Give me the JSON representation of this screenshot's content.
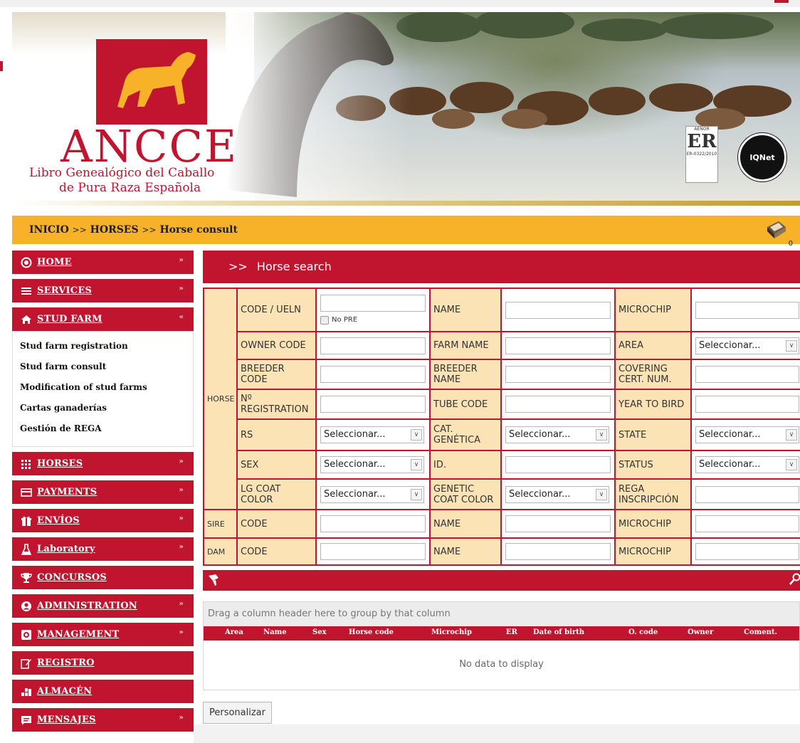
{
  "banner": {
    "brand": "ANCCE",
    "subtitle_line1": "Libro Genealógico del Caballo",
    "subtitle_line2": "de Pura Raza Española",
    "cert_aenor_top": "AENOR",
    "cert_aenor_mark": "ER",
    "cert_aenor_bottom": "ER-0322/2010",
    "cert_iqnet": "IQNet"
  },
  "breadcrumb": {
    "home": "INICIO",
    "sep": ">>",
    "section": "HORSES",
    "page": "Horse consult",
    "cart_count": "0"
  },
  "sidebar": {
    "items": [
      {
        "label": "HOME",
        "icon": "circle-dot-icon"
      },
      {
        "label": "SERVICES",
        "icon": "list-icon"
      },
      {
        "label": "STUD FARM",
        "icon": "home-icon"
      },
      {
        "label": "HORSES",
        "icon": "grid-icon"
      },
      {
        "label": "PAYMENTS",
        "icon": "credit-card-icon"
      },
      {
        "label": "ENVÍOS",
        "icon": "gift-icon"
      },
      {
        "label": "Laboratory",
        "icon": "flask-icon"
      },
      {
        "label": "CONCURSOS",
        "icon": "trophy-icon"
      },
      {
        "label": "ADMINISTRATION",
        "icon": "user-circle-icon"
      },
      {
        "label": "MANAGEMENT",
        "icon": "settings-box-icon"
      },
      {
        "label": "REGISTRO",
        "icon": "edit-icon"
      },
      {
        "label": "ALMACÉN",
        "icon": "warehouse-icon"
      },
      {
        "label": "MENSAJES",
        "icon": "message-icon"
      }
    ],
    "stud_farm_sub": [
      "Stud farm registration",
      "Stud farm consult",
      "Modification of stud farms",
      "Cartas ganaderías",
      "Gestión de REGA"
    ]
  },
  "search": {
    "title": "Horse search",
    "arrows": ">>",
    "groups": {
      "horse": "HORSE",
      "sire": "SIRE",
      "dam": "DAM"
    },
    "labels": {
      "code_ueln": "CODE / UELN",
      "no_pre": "No PRE",
      "name": "NAME",
      "microchip": "MICROCHIP",
      "owner_code": "OWNER CODE",
      "farm_name": "FARM NAME",
      "area": "AREA",
      "breeder_code": "BREEDER CODE",
      "breeder_name": "BREEDER NAME",
      "covering": "COVERING CERT. NUM.",
      "n_registration": "Nº REGISTRATION",
      "tube_code": "TUBE CODE",
      "year_to_bird": "YEAR TO BIRD",
      "rs": "RS",
      "cat_genetica": "CAT. GENÉTICA",
      "state": "STATE",
      "sex": "SEX",
      "id": "ID.",
      "status": "STATUS",
      "lg_coat_color": "LG COAT COLOR",
      "genetic_coat_color": "GENETIC COAT COLOR",
      "rega_inscripcion": "REGA INSCRIPCIÓN",
      "code": "CODE"
    },
    "select_placeholder": "Seleccionar..."
  },
  "grid": {
    "group_hint": "Drag a column header here to group by that column",
    "columns": [
      "Area",
      "Name",
      "Sex",
      "Horse code",
      "Microchip",
      "ER",
      "Date of birth",
      "O. code",
      "Owner",
      "Coment."
    ],
    "empty": "No data to display"
  },
  "buttons": {
    "personalizar": "Personalizar"
  },
  "colors": {
    "primary_red": "#c0142f",
    "breadcrumb_yellow": "#f8b22a",
    "label_cell": "#fbe3b6"
  }
}
